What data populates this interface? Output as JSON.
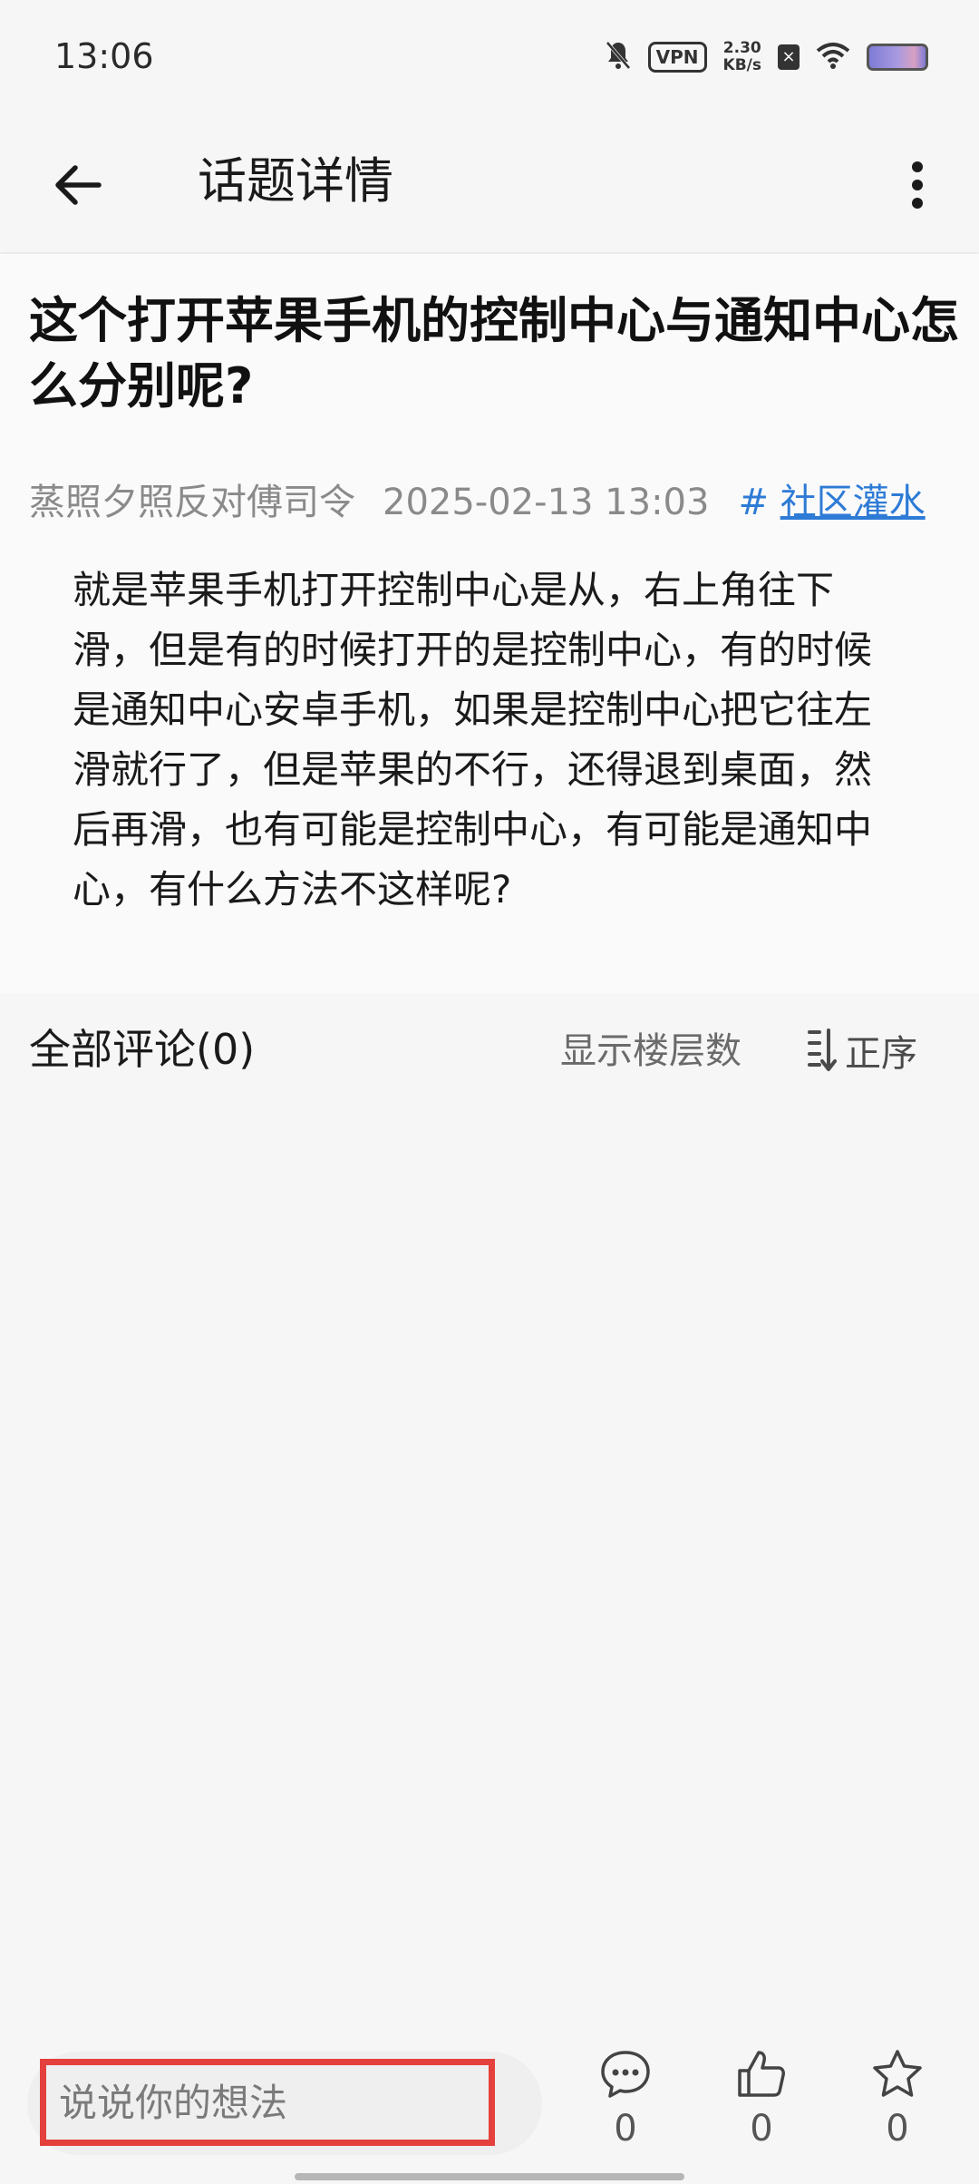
{
  "status_bar": {
    "time": "13:06",
    "vpn_label": "VPN",
    "net_speed_value": "2.30",
    "net_speed_unit": "KB/s",
    "icons": [
      "bell-off-icon",
      "vpn-icon",
      "network-speed",
      "no-sim-icon",
      "wifi-icon",
      "battery-icon"
    ]
  },
  "app_bar": {
    "title": "话题详情",
    "back_icon": "arrow-left-icon",
    "more_icon": "more-vertical-icon"
  },
  "post": {
    "title": "这个打开苹果手机的控制中心与通知中心怎么分别呢?",
    "author": "蒸照夕照反对傅司令",
    "datetime": "2025-02-13 13:03",
    "tag_hash": "#",
    "tag": "社区灌水",
    "body": "就是苹果手机打开控制中心是从，右上角往下滑，但是有的时候打开的是控制中心，有的时候是通知中心安卓手机，如果是控制中心把它往左滑就行了，但是苹果的不行，还得退到桌面，然后再滑，也有可能是控制中心，有可能是通知中心，有什么方法不这样呢?"
  },
  "comments": {
    "header": "全部评论(0)",
    "floor_toggle": "显示楼层数",
    "sort_label": "正序"
  },
  "bottom_bar": {
    "input_placeholder": "说说你的想法",
    "comment_count": "0",
    "like_count": "0",
    "favorite_count": "0"
  },
  "colors": {
    "accent_link": "#2e7bd6",
    "highlight_border": "#e4413c",
    "background": "#f6f6f7"
  }
}
